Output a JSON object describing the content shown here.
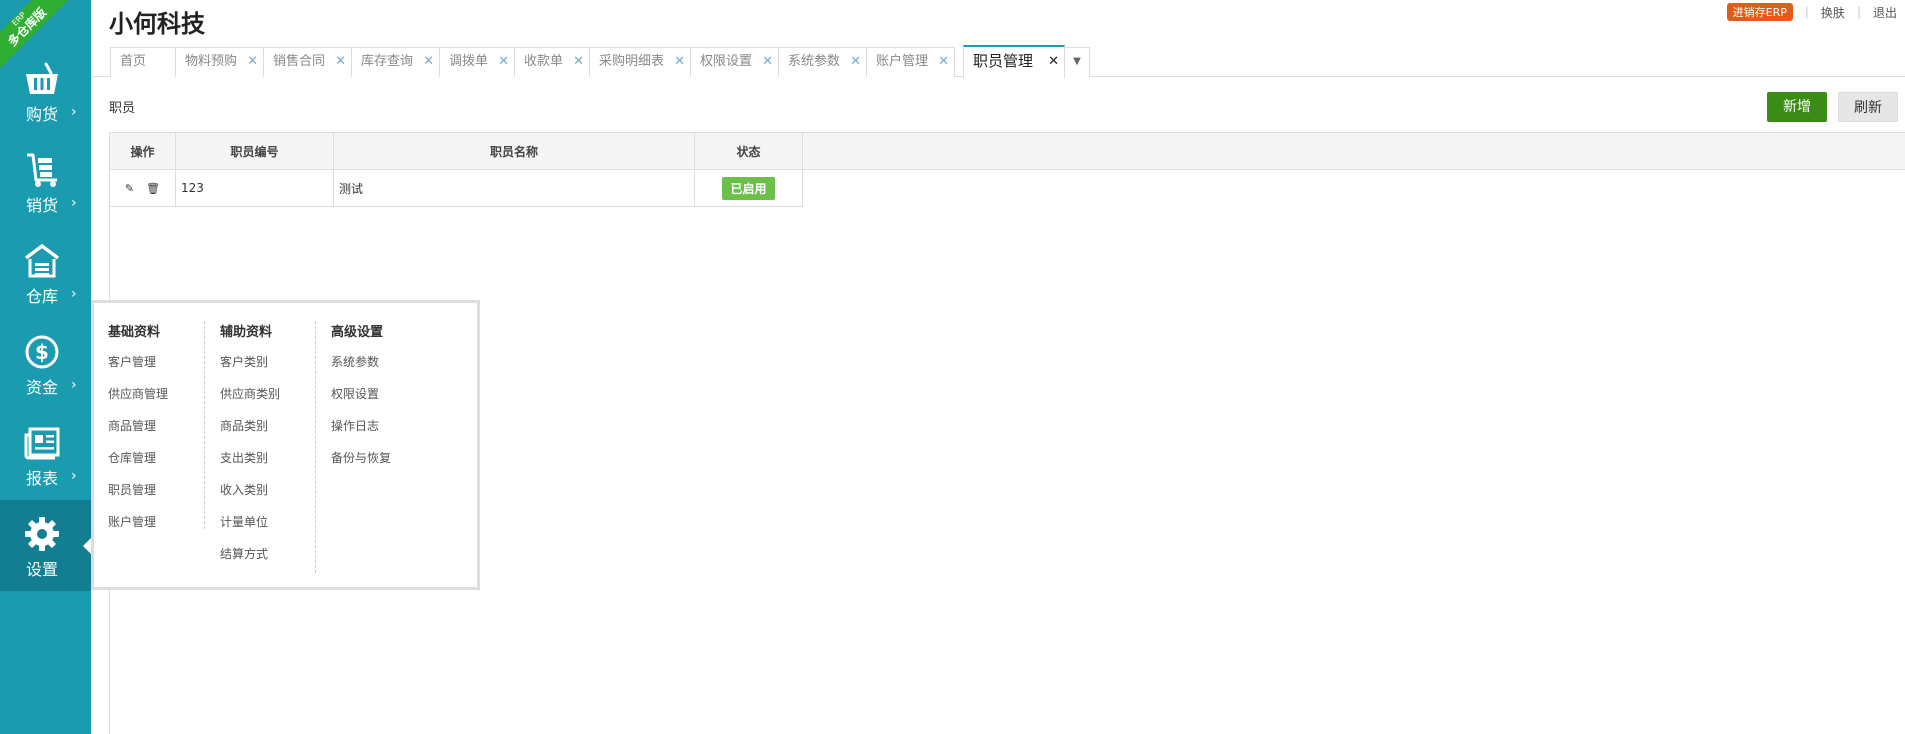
{
  "ribbon": {
    "top": "ERP",
    "main": "多仓库版"
  },
  "nav": [
    {
      "label": "购货",
      "icon": "basket-icon"
    },
    {
      "label": "销货",
      "icon": "cart-icon"
    },
    {
      "label": "仓库",
      "icon": "warehouse-icon"
    },
    {
      "label": "资金",
      "icon": "dollar-icon"
    },
    {
      "label": "报表",
      "icon": "report-icon"
    },
    {
      "label": "设置",
      "icon": "gear-icon"
    }
  ],
  "nav_arrow": "›",
  "brand": "小何科技",
  "top": {
    "badge": "进销存ERP",
    "skin": "换肤",
    "logout": "退出"
  },
  "tabs": [
    "首页",
    "物料预购",
    "销售合同",
    "库存查询",
    "调拨单",
    "收款单",
    "采购明细表",
    "权限设置",
    "系统参数",
    "账户管理",
    "职员管理"
  ],
  "tab_close": "✕",
  "section_title": "职员",
  "buttons": {
    "add": "新增",
    "refresh": "刷新"
  },
  "table": {
    "headers": [
      "操作",
      "职员编号",
      "职员名称",
      "状态"
    ],
    "rows": [
      {
        "code": "123",
        "name": "测试",
        "status": "已启用"
      }
    ]
  },
  "flyout": {
    "columns": [
      {
        "title": "基础资料",
        "items": [
          "客户管理",
          "供应商管理",
          "商品管理",
          "仓库管理",
          "职员管理",
          "账户管理"
        ]
      },
      {
        "title": "辅助资料",
        "items": [
          "客户类别",
          "供应商类别",
          "商品类别",
          "支出类别",
          "收入类别",
          "计量单位",
          "结算方式"
        ]
      },
      {
        "title": "高级设置",
        "items": [
          "系统参数",
          "权限设置",
          "操作日志",
          "备份与恢复"
        ]
      }
    ]
  },
  "colors": {
    "sidebar": "#1a9bb0",
    "sidebar_active": "#137e91",
    "primary": "#3b8c16",
    "status": "#6cc04a",
    "erp_badge": "#e35b1a"
  }
}
